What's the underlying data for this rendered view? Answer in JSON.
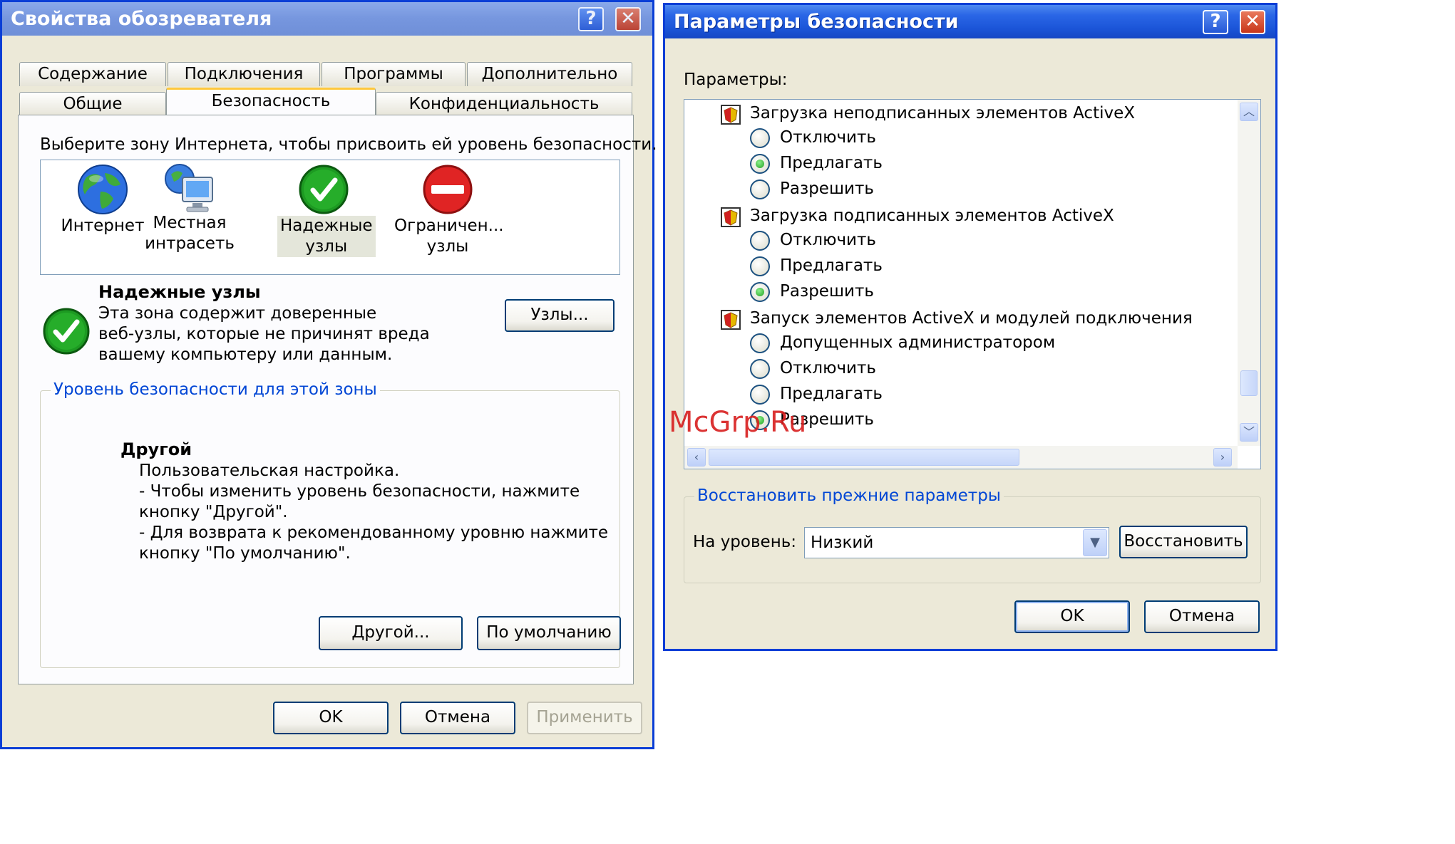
{
  "left_window": {
    "title": "Свойства обозревателя",
    "help_glyph": "?",
    "close_glyph": "✕",
    "tabs_row1": [
      "Содержание",
      "Подключения",
      "Программы",
      "Дополнительно"
    ],
    "tabs_row2": [
      "Общие",
      "Безопасность",
      "Конфиденциальность"
    ],
    "active_tab": "Безопасность",
    "zone_prompt": "Выберите зону Интернета, чтобы присвоить ей уровень безопасности.",
    "zones": [
      {
        "line1": "Интернет",
        "line2": "",
        "icon": "globe-icon"
      },
      {
        "line1": "Местная",
        "line2": "интрасеть",
        "icon": "intranet-computer-icon"
      },
      {
        "line1": "Надежные",
        "line2": "узлы",
        "icon": "trusted-check-icon"
      },
      {
        "line1": "Ограничен...",
        "line2": "узлы",
        "icon": "restricted-no-entry-icon"
      }
    ],
    "selected_zone_index": 2,
    "zone_name": "Надежные узлы",
    "zone_desc": [
      "Эта зона содержит доверенные",
      "веб-узлы, которые не причинят вреда",
      "вашему компьютеру или данным."
    ],
    "sites_button": "Узлы...",
    "level_group_title": "Уровень безопасности для этой зоны",
    "level_name": "Другой",
    "level_desc": [
      "Пользовательская настройка.",
      "- Чтобы изменить уровень безопасности, нажмите",
      "кнопку \"Другой\".",
      "- Для возврата к рекомендованному уровню нажмите",
      "кнопку \"По умолчанию\"."
    ],
    "custom_button": "Другой...",
    "default_button": "По умолчанию",
    "ok": "OK",
    "cancel": "Отмена",
    "apply": "Применить"
  },
  "right_window": {
    "title": "Параметры безопасности",
    "help_glyph": "?",
    "close_glyph": "✕",
    "params_label": "Параметры:",
    "settings": [
      {
        "name": "Загрузка неподписанных элементов ActiveX",
        "options": [
          {
            "label": "Отключить",
            "checked": false
          },
          {
            "label": "Предлагать",
            "checked": true
          },
          {
            "label": "Разрешить",
            "checked": false
          }
        ]
      },
      {
        "name": "Загрузка подписанных элементов ActiveX",
        "options": [
          {
            "label": "Отключить",
            "checked": false
          },
          {
            "label": "Предлагать",
            "checked": false
          },
          {
            "label": "Разрешить",
            "checked": true
          }
        ]
      },
      {
        "name": "Запуск элементов ActiveX и модулей подключения",
        "options": [
          {
            "label": "Допущенных администратором",
            "checked": false
          },
          {
            "label": "Отключить",
            "checked": false
          },
          {
            "label": "Предлагать",
            "checked": false
          },
          {
            "label": "Разрешить",
            "checked": true
          }
        ]
      }
    ],
    "reset_group_title": "Восстановить прежние параметры",
    "level_label": "На уровень:",
    "level_value": "Низкий",
    "restore_button": "Восстановить",
    "ok": "OK",
    "cancel": "Отмена"
  },
  "watermark": "McGrp.Ru",
  "colors": {
    "title_active": "#1b55d8",
    "accent_link": "#0046d5",
    "watermark": "#d81e1e",
    "tab_highlight": "#ffc83c"
  }
}
